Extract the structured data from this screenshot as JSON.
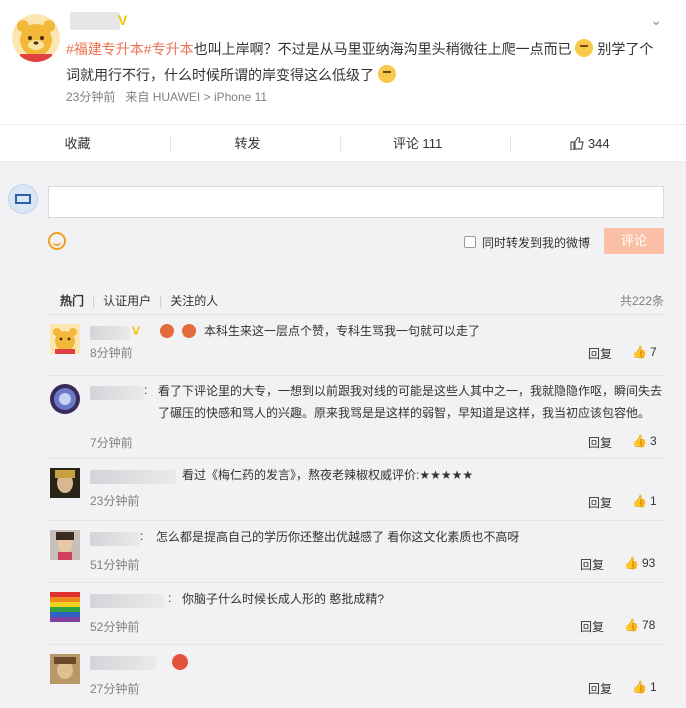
{
  "post": {
    "verified_mark": "V",
    "tag1": "#福建专升本#",
    "tag2": "专升本",
    "text_after_tags": "也叫上岸啊？不过是从马里亚纳海沟里头稍微往上爬一点而已",
    "text_line2": "别学了个词就用行不行，什么时候所谓的岸变得这么低级了",
    "time": "23分钟前",
    "source": "来自 HUAWEI > iPhone 11",
    "caret": "⌄"
  },
  "actions": {
    "favorite": "收藏",
    "repost": "转发",
    "comment": "评论 111",
    "like": "344"
  },
  "composer": {
    "checkbox_label": "同时转发到我的微博",
    "submit_label": "评论"
  },
  "filter": {
    "hot": "热门",
    "verified": "认证用户",
    "following": "关注的人",
    "total": "共222条"
  },
  "comments": [
    {
      "text": "本科生来这一层点个赞，专科生骂我一句就可以走了",
      "time": "8分钟前",
      "reply": "回复",
      "likes": "7"
    },
    {
      "text": "看了下评论里的大专，一想到以前跟我对线的可能是这些人其中之一，我就隐隐作呕，瞬间失去了碾压的快感和骂人的兴趣。原来我骂是是这样的弱智，早知道是这样，我当初应该包容他。",
      "time": "7分钟前",
      "reply": "回复",
      "likes": "3"
    },
    {
      "text": "看过《梅仁药的发言》，熬夜老辣椒权威评价:★★★★★",
      "time": "23分钟前",
      "reply": "回复",
      "likes": "1"
    },
    {
      "text": "怎么都是提高自己的学历你还整出优越感了 看你这文化素质也不高呀",
      "time": "51分钟前",
      "reply": "回复",
      "likes": "93"
    },
    {
      "text": "你脑子什么时候长成人形的 憨批成精?",
      "time": "52分钟前",
      "reply": "回复",
      "likes": "78"
    },
    {
      "text": "",
      "time": "27分钟前",
      "reply": "回复",
      "likes": "1"
    }
  ]
}
